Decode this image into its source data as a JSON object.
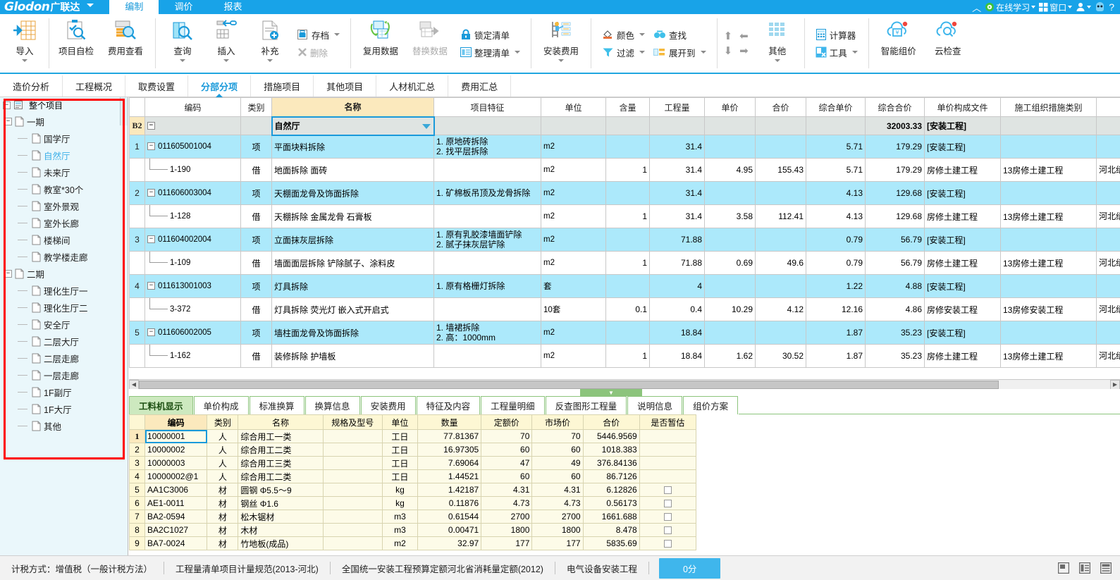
{
  "titlebar": {
    "logo_latin": "Glodon",
    "logo_cn": "广联达",
    "tabs": [
      {
        "label": "编制",
        "active": true
      },
      {
        "label": "调价",
        "active": false
      },
      {
        "label": "报表",
        "active": false
      }
    ],
    "right_items": [
      {
        "icon": "chevron-up-icon",
        "label": ""
      },
      {
        "icon": "online-learning-icon",
        "label": "在线学习",
        "caret": true
      },
      {
        "icon": "window-icon",
        "label": "窗口",
        "caret": true
      },
      {
        "icon": "user-icon",
        "label": "",
        "caret": true
      },
      {
        "icon": "avatar-icon",
        "label": ""
      },
      {
        "icon": "help-icon",
        "label": "?"
      }
    ]
  },
  "ribbon": {
    "groups": [
      {
        "buttons": [
          {
            "name": "import",
            "label": "导入",
            "icon": "import-icon",
            "dropdown": true,
            "big": true
          },
          {
            "name": "project-self-check",
            "label": "项目自检",
            "icon": "self-check-icon",
            "big": true
          },
          {
            "name": "fee-view",
            "label": "费用查看",
            "icon": "fee-view-icon",
            "big": true
          }
        ]
      },
      {
        "buttons": [
          {
            "name": "query",
            "label": "查询",
            "icon": "query-icon",
            "dropdown": true,
            "big": true
          },
          {
            "name": "insert",
            "label": "插入",
            "icon": "insert-icon",
            "dropdown": true,
            "big": true
          },
          {
            "name": "supplement",
            "label": "补充",
            "icon": "supplement-icon",
            "dropdown": true,
            "big": true
          }
        ],
        "small": [
          {
            "name": "archive",
            "label": "存档",
            "icon": "archive-icon",
            "dropdown": true,
            "disabled": false
          },
          {
            "name": "delete",
            "label": "删除",
            "icon": "delete-icon",
            "dropdown": false,
            "disabled": true
          }
        ]
      },
      {
        "buttons": [
          {
            "name": "reuse-data",
            "label": "复用数据",
            "icon": "reuse-data-icon",
            "big": true
          },
          {
            "name": "replace-data",
            "label": "替换数据",
            "icon": "replace-data-icon",
            "big": true,
            "disabled": true
          }
        ],
        "small": [
          {
            "name": "lock-list",
            "label": "锁定清单",
            "icon": "lock-icon"
          },
          {
            "name": "organize-list",
            "label": "整理清单",
            "icon": "organize-icon",
            "dropdown": true
          }
        ]
      },
      {
        "buttons": [
          {
            "name": "install-fee",
            "label": "安装费用",
            "icon": "install-fee-icon",
            "dropdown": true,
            "big": true
          }
        ]
      },
      {
        "small2": [
          {
            "name": "color",
            "label": "颜色",
            "icon": "color-icon",
            "dropdown": true
          },
          {
            "name": "find",
            "label": "查找",
            "icon": "find-icon"
          },
          {
            "name": "filter",
            "label": "过滤",
            "icon": "filter-icon",
            "dropdown": true
          },
          {
            "name": "expand-to",
            "label": "展开到",
            "icon": "expand-to-icon",
            "dropdown": true
          }
        ]
      },
      {
        "arrows": [
          "↑",
          "←",
          "↓",
          "→"
        ]
      },
      {
        "buttons": [
          {
            "name": "other",
            "label": "其他",
            "icon": "other-grid-icon",
            "dropdown": true,
            "big": true
          }
        ]
      },
      {
        "small": [
          {
            "name": "calculator",
            "label": "计算器",
            "icon": "calculator-icon"
          },
          {
            "name": "tools",
            "label": "工具",
            "icon": "tools-icon",
            "dropdown": true
          }
        ]
      },
      {
        "buttons": [
          {
            "name": "smart-pricing",
            "label": "智能组价",
            "icon": "smart-pricing-icon",
            "badge": true,
            "big": true
          },
          {
            "name": "cloud-check",
            "label": "云检查",
            "icon": "cloud-check-icon",
            "badge": true,
            "big": true
          }
        ]
      }
    ]
  },
  "module_tabs": [
    {
      "label": "造价分析",
      "active": false
    },
    {
      "label": "工程概况",
      "active": false
    },
    {
      "label": "取费设置",
      "active": false
    },
    {
      "label": "分部分项",
      "active": true
    },
    {
      "label": "措施项目",
      "active": false
    },
    {
      "label": "其他项目",
      "active": false
    },
    {
      "label": "人材机汇总",
      "active": false
    },
    {
      "label": "费用汇总",
      "active": false
    }
  ],
  "tree": {
    "root": {
      "label": "整个项目",
      "icon": "project-icon"
    },
    "nodes": [
      {
        "label": "一期",
        "level": 1,
        "expander": "−",
        "icon": "file-icon"
      },
      {
        "label": "国学厅",
        "level": 2,
        "icon": "file-icon"
      },
      {
        "label": "自然厅",
        "level": 2,
        "icon": "file-icon",
        "selected": true
      },
      {
        "label": "未来厅",
        "level": 2,
        "icon": "file-icon"
      },
      {
        "label": "教室*30个",
        "level": 2,
        "icon": "file-icon"
      },
      {
        "label": "室外景观",
        "level": 2,
        "icon": "file-icon"
      },
      {
        "label": "室外长廊",
        "level": 2,
        "icon": "file-icon"
      },
      {
        "label": "楼梯间",
        "level": 2,
        "icon": "file-icon"
      },
      {
        "label": "教学楼走廊",
        "level": 2,
        "icon": "file-icon"
      },
      {
        "label": "二期",
        "level": 1,
        "expander": "−",
        "icon": "file-icon"
      },
      {
        "label": "理化生厅一",
        "level": 2,
        "icon": "file-icon"
      },
      {
        "label": "理化生厅二",
        "level": 2,
        "icon": "file-icon"
      },
      {
        "label": "安全厅",
        "level": 2,
        "icon": "file-icon"
      },
      {
        "label": "二层大厅",
        "level": 2,
        "icon": "file-icon"
      },
      {
        "label": "二层走廊",
        "level": 2,
        "icon": "file-icon"
      },
      {
        "label": "一层走廊",
        "level": 2,
        "icon": "file-icon"
      },
      {
        "label": "1F副厅",
        "level": 2,
        "icon": "file-icon"
      },
      {
        "label": "1F大厅",
        "level": 2,
        "icon": "file-icon"
      },
      {
        "label": "其他",
        "level": 2,
        "icon": "file-icon"
      }
    ]
  },
  "main_grid": {
    "columns": [
      "编码",
      "类别",
      "名称",
      "项目特征",
      "单位",
      "含量",
      "工程量",
      "单价",
      "合价",
      "综合单价",
      "综合合价",
      "单价构成文件",
      "施工组织措施类别",
      ""
    ],
    "rows": [
      {
        "level": 0,
        "rownum": "B2",
        "expander": "−",
        "code": "",
        "cat": "",
        "name": "自然厅",
        "name_editing": true,
        "feature": "",
        "unit": "",
        "ratio": "",
        "qty": "",
        "price": "",
        "total": "",
        "comp_price": "",
        "comp_total": "32003.33",
        "file": "[安装工程]",
        "measure": "",
        "extra": ""
      },
      {
        "level": 1,
        "rownum": "1",
        "expander": "−",
        "code": "011605001004",
        "cat": "项",
        "name": "平面块料拆除",
        "feature": "1. 原地砖拆除\n2. 找平层拆除",
        "unit": "m2",
        "ratio": "",
        "qty": "31.4",
        "price": "",
        "total": "",
        "comp_price": "5.71",
        "comp_total": "179.29",
        "file": "[安装工程]",
        "measure": "",
        "extra": ""
      },
      {
        "level": 2,
        "rownum": "",
        "expander": "",
        "code": "1-190",
        "cat": "借",
        "name": "地面拆除 面砖",
        "feature": "",
        "unit": "m2",
        "ratio": "1",
        "qty": "31.4",
        "price": "4.95",
        "total": "155.43",
        "comp_price": "5.71",
        "comp_total": "179.29",
        "file": "房修土建工程",
        "measure": "13房修土建工程",
        "extra": "河北缮工定额"
      },
      {
        "level": 1,
        "rownum": "2",
        "expander": "−",
        "code": "011606003004",
        "cat": "项",
        "name": "天棚面龙骨及饰面拆除",
        "feature": "1. 矿棉板吊顶及龙骨拆除",
        "unit": "m2",
        "ratio": "",
        "qty": "31.4",
        "price": "",
        "total": "",
        "comp_price": "4.13",
        "comp_total": "129.68",
        "file": "[安装工程]",
        "measure": "",
        "extra": ""
      },
      {
        "level": 2,
        "rownum": "",
        "expander": "",
        "code": "1-128",
        "cat": "借",
        "name": "天棚拆除 金属龙骨 石膏板",
        "feature": "",
        "unit": "m2",
        "ratio": "1",
        "qty": "31.4",
        "price": "3.58",
        "total": "112.41",
        "comp_price": "4.13",
        "comp_total": "129.68",
        "file": "房修土建工程",
        "measure": "13房修土建工程",
        "extra": "河北缮工定额"
      },
      {
        "level": 1,
        "rownum": "3",
        "expander": "−",
        "code": "011604002004",
        "cat": "项",
        "name": "立面抹灰层拆除",
        "feature": "1. 原有乳胶漆墙面铲除\n2. 腻子抹灰层铲除",
        "unit": "m2",
        "ratio": "",
        "qty": "71.88",
        "price": "",
        "total": "",
        "comp_price": "0.79",
        "comp_total": "56.79",
        "file": "[安装工程]",
        "measure": "",
        "extra": ""
      },
      {
        "level": 2,
        "rownum": "",
        "expander": "",
        "code": "1-109",
        "cat": "借",
        "name": "墙面面层拆除 铲除腻子、涂料皮",
        "feature": "",
        "unit": "m2",
        "ratio": "1",
        "qty": "71.88",
        "price": "0.69",
        "total": "49.6",
        "comp_price": "0.79",
        "comp_total": "56.79",
        "file": "房修土建工程",
        "measure": "13房修土建工程",
        "extra": "河北缮工定额"
      },
      {
        "level": 1,
        "rownum": "4",
        "expander": "−",
        "code": "011613001003",
        "cat": "项",
        "name": "灯具拆除",
        "feature": "1. 原有格栅灯拆除",
        "unit": "套",
        "ratio": "",
        "qty": "4",
        "price": "",
        "total": "",
        "comp_price": "1.22",
        "comp_total": "4.88",
        "file": "[安装工程]",
        "measure": "",
        "extra": ""
      },
      {
        "level": 2,
        "rownum": "",
        "expander": "",
        "code": "3-372",
        "cat": "借",
        "name": "灯具拆除 荧光灯 嵌入式开启式",
        "feature": "",
        "unit": "10套",
        "ratio": "0.1",
        "qty": "0.4",
        "price": "10.29",
        "total": "4.12",
        "comp_price": "12.16",
        "comp_total": "4.86",
        "file": "房修安装工程",
        "measure": "13房修安装工程",
        "extra": "河北缮工定额"
      },
      {
        "level": 1,
        "rownum": "5",
        "expander": "−",
        "code": "011606002005",
        "cat": "项",
        "name": "墙柱面龙骨及饰面拆除",
        "feature": "1. 墙裙拆除\n2. 高：1000mm",
        "unit": "m2",
        "ratio": "",
        "qty": "18.84",
        "price": "",
        "total": "",
        "comp_price": "1.87",
        "comp_total": "35.23",
        "file": "[安装工程]",
        "measure": "",
        "extra": ""
      },
      {
        "level": 2,
        "rownum": "",
        "expander": "",
        "code": "1-162",
        "cat": "借",
        "name": "装修拆除 护墙板",
        "feature": "",
        "unit": "m2",
        "ratio": "1",
        "qty": "18.84",
        "price": "1.62",
        "total": "30.52",
        "comp_price": "1.87",
        "comp_total": "35.23",
        "file": "房修土建工程",
        "measure": "13房修土建工程",
        "extra": "河北缮工定额"
      }
    ]
  },
  "bottom_tabs": [
    {
      "label": "工料机显示",
      "active": true
    },
    {
      "label": "单价构成",
      "active": false
    },
    {
      "label": "标准换算",
      "active": false
    },
    {
      "label": "换算信息",
      "active": false
    },
    {
      "label": "安装费用",
      "active": false
    },
    {
      "label": "特征及内容",
      "active": false
    },
    {
      "label": "工程量明细",
      "active": false
    },
    {
      "label": "反查图形工程量",
      "active": false
    },
    {
      "label": "说明信息",
      "active": false
    },
    {
      "label": "组价方案",
      "active": false
    }
  ],
  "bottom_grid": {
    "columns": [
      "编码",
      "类别",
      "名称",
      "规格及型号",
      "单位",
      "数量",
      "定额价",
      "市场价",
      "合价",
      "是否暂估"
    ],
    "rows": [
      {
        "rn": "1",
        "code": "10000001",
        "cat": "人",
        "name": "综合用工一类",
        "spec": "",
        "unit": "工日",
        "qty": "77.81367",
        "std_price": "70",
        "mkt_price": "70",
        "total": "5446.9569",
        "prov": false,
        "selected": true
      },
      {
        "rn": "2",
        "code": "10000002",
        "cat": "人",
        "name": "综合用工二类",
        "spec": "",
        "unit": "工日",
        "qty": "16.97305",
        "std_price": "60",
        "mkt_price": "60",
        "total": "1018.383",
        "prov": false
      },
      {
        "rn": "3",
        "code": "10000003",
        "cat": "人",
        "name": "综合用工三类",
        "spec": "",
        "unit": "工日",
        "qty": "7.69064",
        "std_price": "47",
        "mkt_price": "49",
        "total": "376.84136",
        "prov": false
      },
      {
        "rn": "4",
        "code": "10000002@1",
        "cat": "人",
        "name": "综合用工二类",
        "spec": "",
        "unit": "工日",
        "qty": "1.44521",
        "std_price": "60",
        "mkt_price": "60",
        "total": "86.7126",
        "prov": false
      },
      {
        "rn": "5",
        "code": "AA1C3006",
        "cat": "材",
        "name": "圆钢 Φ5.5～9",
        "spec": "",
        "unit": "kg",
        "qty": "1.42187",
        "std_price": "4.31",
        "mkt_price": "4.31",
        "total": "6.12826",
        "prov": true
      },
      {
        "rn": "6",
        "code": "AE1-0011",
        "cat": "材",
        "name": "钢丝 Φ1.6",
        "spec": "",
        "unit": "kg",
        "qty": "0.11876",
        "std_price": "4.73",
        "mkt_price": "4.73",
        "total": "0.56173",
        "prov": true
      },
      {
        "rn": "7",
        "code": "BA2-0594",
        "cat": "材",
        "name": "松木锯材",
        "spec": "",
        "unit": "m3",
        "qty": "0.61544",
        "std_price": "2700",
        "mkt_price": "2700",
        "total": "1661.688",
        "prov": true
      },
      {
        "rn": "8",
        "code": "BA2C1027",
        "cat": "材",
        "name": "木材",
        "spec": "",
        "unit": "m3",
        "qty": "0.00471",
        "std_price": "1800",
        "mkt_price": "1800",
        "total": "8.478",
        "prov": true
      },
      {
        "rn": "9",
        "code": "BA7-0024",
        "cat": "材",
        "name": "竹地板(成品)",
        "spec": "",
        "unit": "m2",
        "qty": "32.97",
        "std_price": "177",
        "mkt_price": "177",
        "total": "5835.69",
        "prov": true
      }
    ]
  },
  "statusbar": {
    "items": [
      "计税方式：增值税（一般计税方法）",
      "工程量清单项目计量规范(2013-河北)",
      "全国统一安装工程预算定额河北省消耗量定额(2012)",
      "电气设备安装工程"
    ],
    "score_button": "0分",
    "right_icons": [
      "panel-layout-icon",
      "list-view-icon",
      "grid-view-icon"
    ]
  },
  "colors": {
    "brand_blue": "#18a3e8",
    "accent_blue": "#1a9ada",
    "row_highlight": "#ace9fb",
    "row_group": "#dfe4e2",
    "name_header": "#fbe9bd",
    "bottom_green": "#8cc47c",
    "bottom_tab_active": "#cde9bf",
    "tree_bg": "#eaf7fb",
    "highlight_box": "#ff0000"
  }
}
